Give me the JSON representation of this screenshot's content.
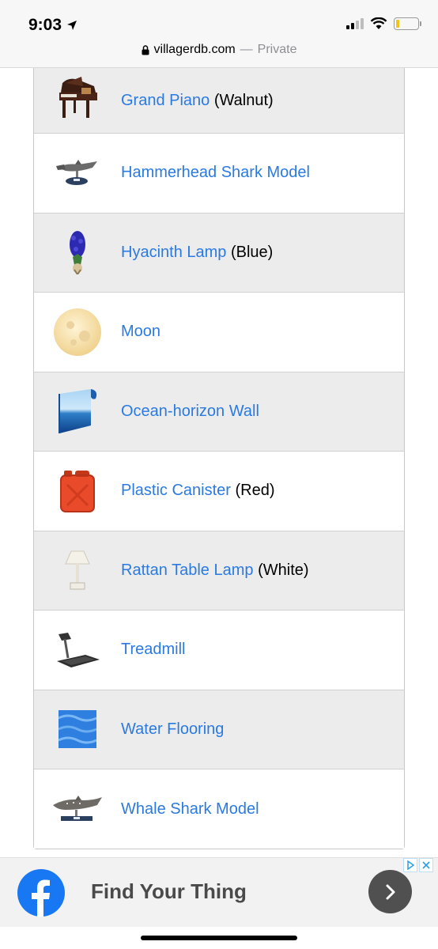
{
  "status_bar": {
    "time": "9:03"
  },
  "url_bar": {
    "domain": "villagerdb.com",
    "separator": " — ",
    "mode": "Private"
  },
  "items": [
    {
      "name": "Grand Piano",
      "variant": "(Walnut)",
      "icon": "grand-piano-icon"
    },
    {
      "name": "Hammerhead Shark Model",
      "variant": "",
      "icon": "hammerhead-shark-model-icon"
    },
    {
      "name": "Hyacinth Lamp",
      "variant": "(Blue)",
      "icon": "hyacinth-lamp-icon"
    },
    {
      "name": "Moon",
      "variant": "",
      "icon": "moon-icon"
    },
    {
      "name": "Ocean-horizon Wall",
      "variant": "",
      "icon": "ocean-horizon-wall-icon"
    },
    {
      "name": "Plastic Canister",
      "variant": "(Red)",
      "icon": "plastic-canister-icon"
    },
    {
      "name": "Rattan Table Lamp",
      "variant": "(White)",
      "icon": "rattan-table-lamp-icon"
    },
    {
      "name": "Treadmill",
      "variant": "",
      "icon": "treadmill-icon"
    },
    {
      "name": "Water Flooring",
      "variant": "",
      "icon": "water-flooring-icon"
    },
    {
      "name": "Whale Shark Model",
      "variant": "",
      "icon": "whale-shark-model-icon"
    }
  ],
  "ad": {
    "title": "Find Your Thing",
    "brand_icon": "facebook-icon",
    "brand_color": "#1877f2"
  },
  "colors": {
    "link": "#2a7ae2",
    "row_alt": "#ececec"
  }
}
